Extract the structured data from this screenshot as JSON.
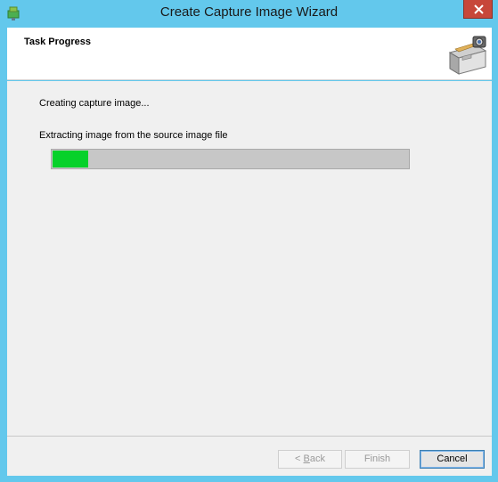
{
  "window": {
    "title": "Create Capture Image Wizard",
    "icons": {
      "app": "wizard-app-icon",
      "close": "close-icon",
      "header": "file-cabinet-camera-icon"
    }
  },
  "header": {
    "title": "Task Progress"
  },
  "body": {
    "status": "Creating capture image...",
    "detail": "Extracting image from the source image file",
    "progress": {
      "value": 0.1,
      "fill_color": "#06d12a",
      "track_color": "#c7c7c7"
    }
  },
  "footer": {
    "back_label_prefix": "< ",
    "back_label_mnemonic": "B",
    "back_label_rest": "ack",
    "finish_label": "Finish",
    "cancel_label": "Cancel"
  },
  "colors": {
    "frame": "#63c8ec",
    "close": "#c7473a"
  }
}
